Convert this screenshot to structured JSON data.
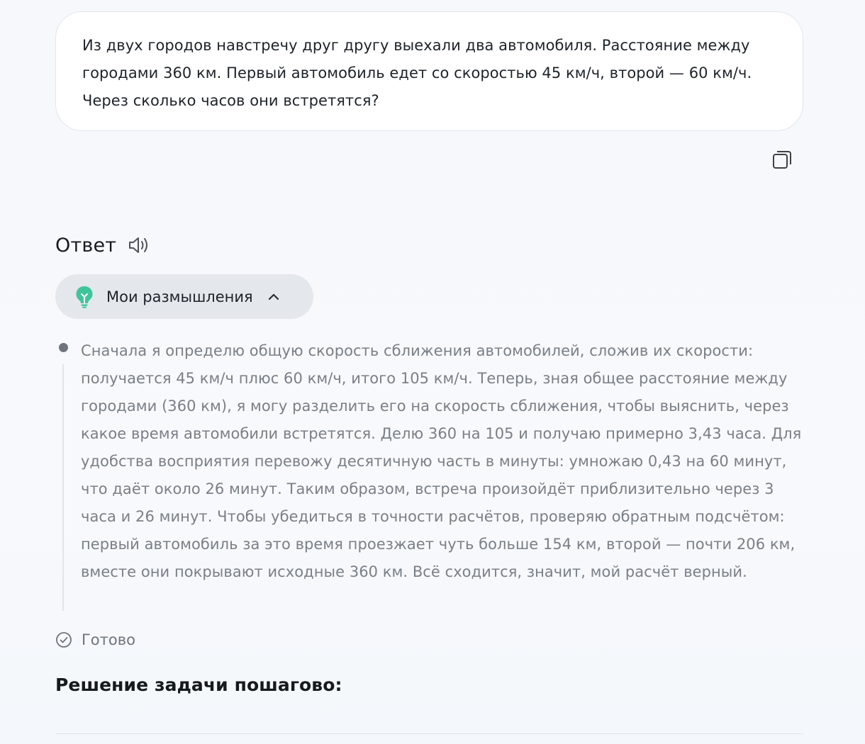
{
  "question": {
    "text": "Из двух городов навстречу друг другу выехали два автомобиля. Расстояние между городами 360 км. Первый автомобиль едет со скоростью 45 км/ч, второй — 60 км/ч. Через сколько часов они встретятся?"
  },
  "toolbar": {
    "copy_icon": "copy-icon"
  },
  "answer": {
    "title": "Ответ",
    "speaker_icon": "speaker-icon"
  },
  "thoughts": {
    "label": "Мои размышления",
    "icon": "lightbulb-icon",
    "icon_color": "#3fc59a",
    "expanded": true,
    "text": "Сначала я определю общую скорость сближения автомобилей, сложив их скорости: получается 45 км/ч плюс 60 км/ч, итого 105 км/ч. Теперь, зная общее расстояние между городами (360 км), я могу разделить его на скорость сближения, чтобы выяснить, через какое время автомобили встретятся. Делю 360 на 105 и получаю примерно 3,43 часа. Для удобства восприятия перевожу десятичную часть в минуты: умножаю 0,43 на 60 минут, что даёт около 26 минут. Таким образом, встреча произойдёт приблизительно через 3 часа и 26 минут. Чтобы убедиться в точности расчётов, проверяю обратным подсчётом: первый автомобиль за это время проезжает чуть больше 154 км, второй — почти 206 км, вместе они покрывают исходные 360 км. Всё сходится, значит, мой расчёт верный."
  },
  "status": {
    "text": "Готово",
    "icon": "check-circle-icon"
  },
  "solution": {
    "heading": "Решение задачи пошагово:"
  }
}
